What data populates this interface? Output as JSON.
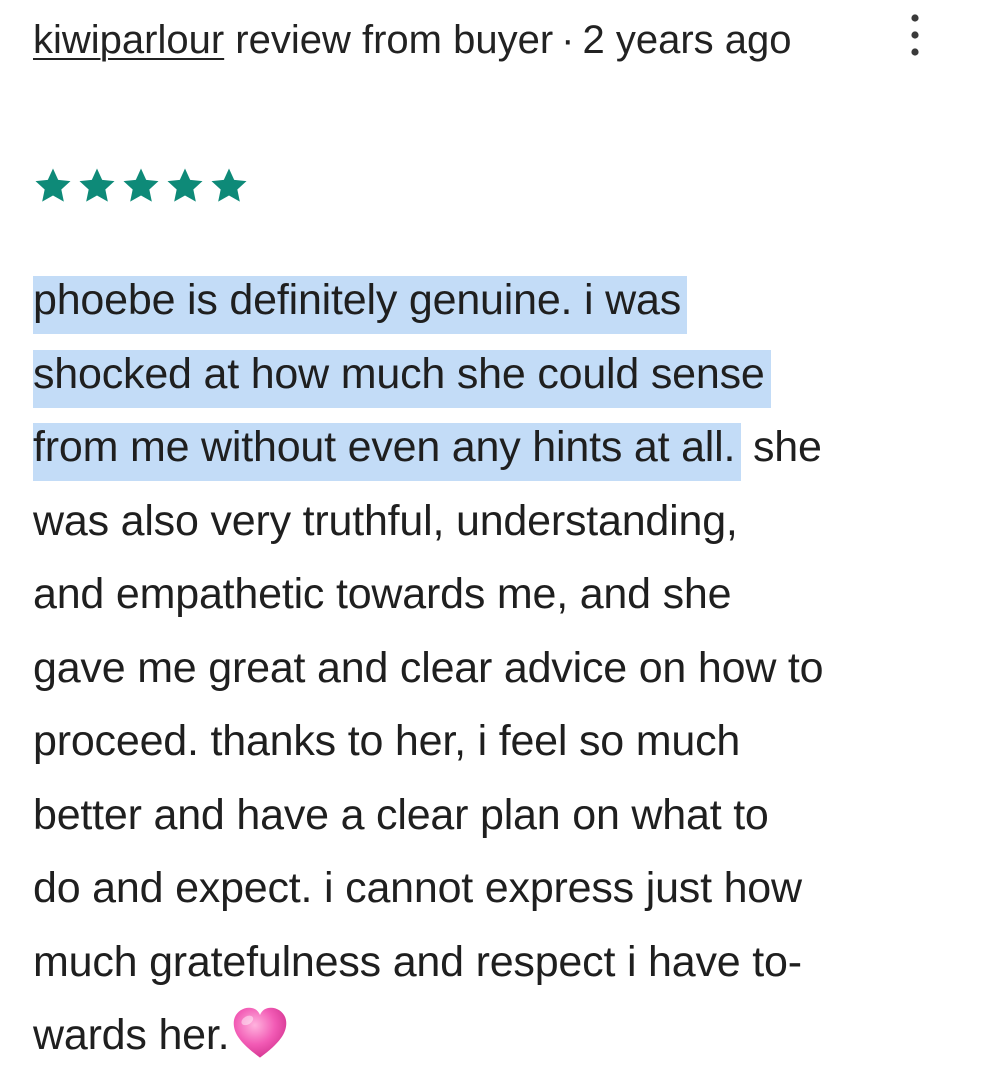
{
  "review": {
    "username": "kiwiparlour",
    "meta_label": "review from buyer",
    "separator": "·",
    "time_ago": "2 years ago",
    "rating": 5,
    "rating_color": "#0e8a78",
    "highlight_color": "#c3dcf7",
    "lines": [
      "phoebe is definitely genuine. i was",
      "shocked at how much she could sense",
      "from me without even any hints at all.",
      " she",
      "was also very truthful, understanding,",
      "and empathetic towards me, and she",
      "gave me great and clear advice on how to",
      "proceed. thanks to her, i feel so much",
      "better and have a clear plan on what to",
      "do and expect. i cannot express just how",
      "much gratefulness and respect i have to-",
      "wards her."
    ],
    "emoji_icon": "pink-heart-icon",
    "more_icon": "kebab-menu-icon"
  }
}
